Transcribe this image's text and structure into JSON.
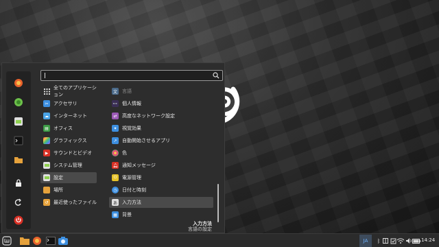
{
  "colors": {
    "accent": "#8fd14f",
    "orange": "#e8622c",
    "red": "#d93025",
    "blue": "#3d8fe0",
    "selected": "#4a4a4a"
  },
  "search": {
    "value": "",
    "placeholder": ""
  },
  "favorites": [
    {
      "icon": "firefox-icon"
    },
    {
      "icon": "software-manager-icon"
    },
    {
      "icon": "settings-icon"
    },
    {
      "icon": "terminal-icon"
    },
    {
      "icon": "folder-icon"
    },
    {
      "icon": "lock-screen-icon"
    },
    {
      "icon": "logout-icon"
    },
    {
      "icon": "power-icon"
    }
  ],
  "categories": [
    {
      "label": "全てのアプリケーション",
      "icon": "grid-icon",
      "color": "#2d2d2d"
    },
    {
      "label": "アクセサリ",
      "icon": "accessories-icon",
      "color": "#3d8fe0"
    },
    {
      "label": "インターネット",
      "icon": "internet-icon",
      "color": "#4aa3e6"
    },
    {
      "label": "オフィス",
      "icon": "office-icon",
      "color": "#3d9b46"
    },
    {
      "label": "グラフィックス",
      "icon": "graphics-icon",
      "color": "#c94fd6"
    },
    {
      "label": "サウンドとビデオ",
      "icon": "multimedia-icon",
      "color": "#d93025"
    },
    {
      "label": "システム管理",
      "icon": "system-icon",
      "color": "#8fd14f"
    },
    {
      "label": "設定",
      "icon": "preferences-icon",
      "color": "#8fd14f"
    },
    {
      "label": "場所",
      "icon": "places-icon",
      "color": "#e6a23c"
    },
    {
      "label": "最近使ったファイル",
      "icon": "recent-icon",
      "color": "#e6a23c"
    }
  ],
  "selected_category": 7,
  "apps": [
    {
      "label": "言語",
      "icon": "language-icon",
      "color": "#4a6a8a",
      "dim": true
    },
    {
      "label": "個人情報",
      "icon": "personal-info-icon",
      "color": "#6b4fa3"
    },
    {
      "label": "高度なネットワーク設定",
      "icon": "network-icon",
      "color": "#9b59b6"
    },
    {
      "label": "視覚効果",
      "icon": "effects-icon",
      "color": "#3d8fe0"
    },
    {
      "label": "自動開始させるアプリ",
      "icon": "startup-icon",
      "color": "#3d8fe0"
    },
    {
      "label": "色",
      "icon": "color-icon",
      "color": "#e04f7a"
    },
    {
      "label": "通知メッセージ",
      "icon": "notifications-icon",
      "color": "#d93025"
    },
    {
      "label": "電源管理",
      "icon": "power-management-icon",
      "color": "#e6c229"
    },
    {
      "label": "日付と時刻",
      "icon": "clock-icon",
      "color": "#3d8fe0"
    },
    {
      "label": "入力方法",
      "icon": "input-method-icon",
      "color": "#e0e0e0"
    },
    {
      "label": "背景",
      "icon": "background-icon",
      "color": "#3d8fe0"
    }
  ],
  "selected_app": 9,
  "description": {
    "title": "入力方法",
    "subtitle": "言語の設定"
  },
  "panel": {
    "language_indicator": "JA",
    "clock": "14:24",
    "launchers": [
      "files-icon",
      "firefox-icon",
      "terminal-icon",
      "screenshot-icon"
    ],
    "tray": [
      "bluetooth-icon",
      "window-list-icon",
      "updates-icon",
      "network-icon",
      "volume-icon",
      "battery-icon"
    ]
  }
}
